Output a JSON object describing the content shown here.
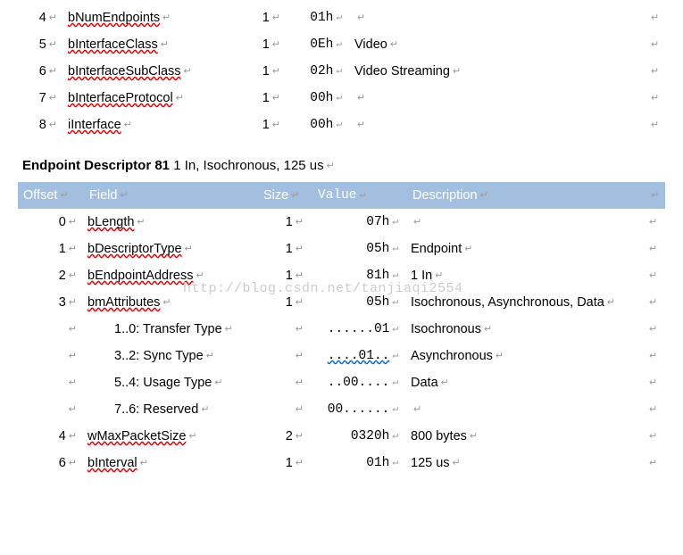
{
  "glyph": "↵",
  "watermark": "http://blog.csdn.net/tanjiaqi2554",
  "top_rows": [
    {
      "offset": "4",
      "field": "bNumEndpoints",
      "field_wavy": true,
      "size": "1",
      "value": "01h",
      "desc": ""
    },
    {
      "offset": "5",
      "field": "bInterfaceClass",
      "field_wavy": true,
      "size": "1",
      "value": "0Eh",
      "desc": "Video"
    },
    {
      "offset": "6",
      "field": "bInterfaceSubClass",
      "field_wavy": true,
      "size": "1",
      "value": "02h",
      "desc": "Video Streaming"
    },
    {
      "offset": "7",
      "field": "bInterfaceProtocol",
      "field_wavy": true,
      "size": "1",
      "value": "00h",
      "desc": ""
    },
    {
      "offset": "8",
      "field": "iInterface",
      "field_wavy": true,
      "size": "1",
      "value": "00h",
      "desc": ""
    }
  ],
  "section": {
    "title": "Endpoint Descriptor 81",
    "sub": "1 In, Isochronous, 125 us"
  },
  "header": {
    "offset": "Offset",
    "field": "Field",
    "size": "Size",
    "value": "Value",
    "desc": "Description"
  },
  "rows": [
    {
      "offset": "0",
      "field": "bLength",
      "field_wavy": true,
      "indent": false,
      "size": "1",
      "value": "07h",
      "value_wavy": "",
      "desc": ""
    },
    {
      "offset": "1",
      "field": "bDescriptorType",
      "field_wavy": true,
      "indent": false,
      "size": "1",
      "value": "05h",
      "value_wavy": "",
      "desc": "Endpoint"
    },
    {
      "offset": "2",
      "field": "bEndpointAddress",
      "field_wavy": true,
      "indent": false,
      "size": "1",
      "value": "81h",
      "value_wavy": "",
      "desc": "1 In"
    },
    {
      "offset": "3",
      "field": "bmAttributes",
      "field_wavy": true,
      "indent": false,
      "size": "1",
      "value": "05h",
      "value_wavy": "",
      "desc": "Isochronous, Asynchronous, Data"
    },
    {
      "offset": "",
      "field": "1..0: Transfer Type",
      "field_wavy": false,
      "indent": true,
      "size": "",
      "value": "......01",
      "value_wavy": "",
      "desc": "Isochronous"
    },
    {
      "offset": "",
      "field": "3..2: Sync Type",
      "field_wavy": false,
      "indent": true,
      "size": "",
      "value": "....01..",
      "value_wavy": "blue",
      "desc": "Asynchronous"
    },
    {
      "offset": "",
      "field": "5..4: Usage Type",
      "field_wavy": false,
      "indent": true,
      "size": "",
      "value": "..00....",
      "value_wavy": "",
      "desc": "Data"
    },
    {
      "offset": "",
      "field": "7..6: Reserved",
      "field_wavy": false,
      "indent": true,
      "size": "",
      "value": "00......",
      "value_wavy": "",
      "desc": ""
    },
    {
      "offset": "4",
      "field": "wMaxPacketSize",
      "field_wavy": true,
      "indent": false,
      "size": "2",
      "value": "0320h",
      "value_wavy": "",
      "desc": "800 bytes"
    },
    {
      "offset": "6",
      "field": "bInterval",
      "field_wavy": true,
      "indent": false,
      "size": "1",
      "value": "01h",
      "value_wavy": "",
      "desc": "125 us"
    }
  ]
}
